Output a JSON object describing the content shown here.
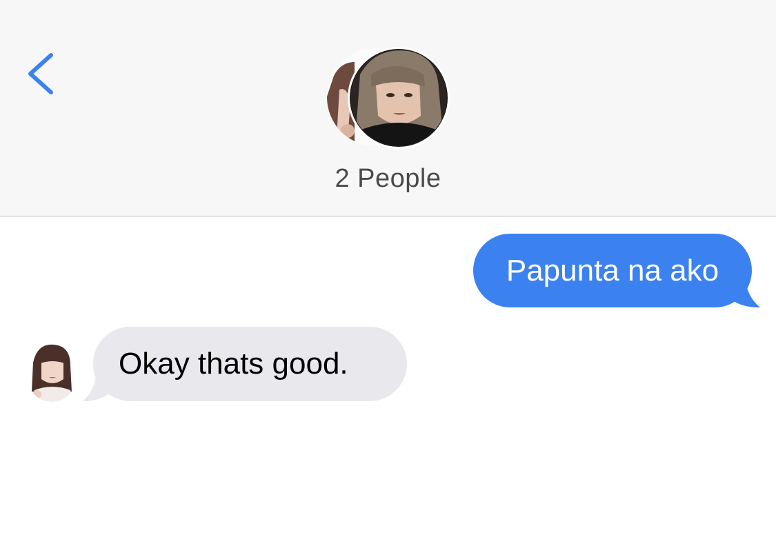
{
  "header": {
    "back_icon": "chevron-left-icon",
    "group_title": "2 People",
    "accent_color": "#3b82f0"
  },
  "messages": [
    {
      "direction": "outgoing",
      "text": "Papunta na ako",
      "bubble_color": "#3b82f0"
    },
    {
      "direction": "incoming",
      "text": "Okay thats good.",
      "bubble_color": "#e8e8ed"
    }
  ]
}
